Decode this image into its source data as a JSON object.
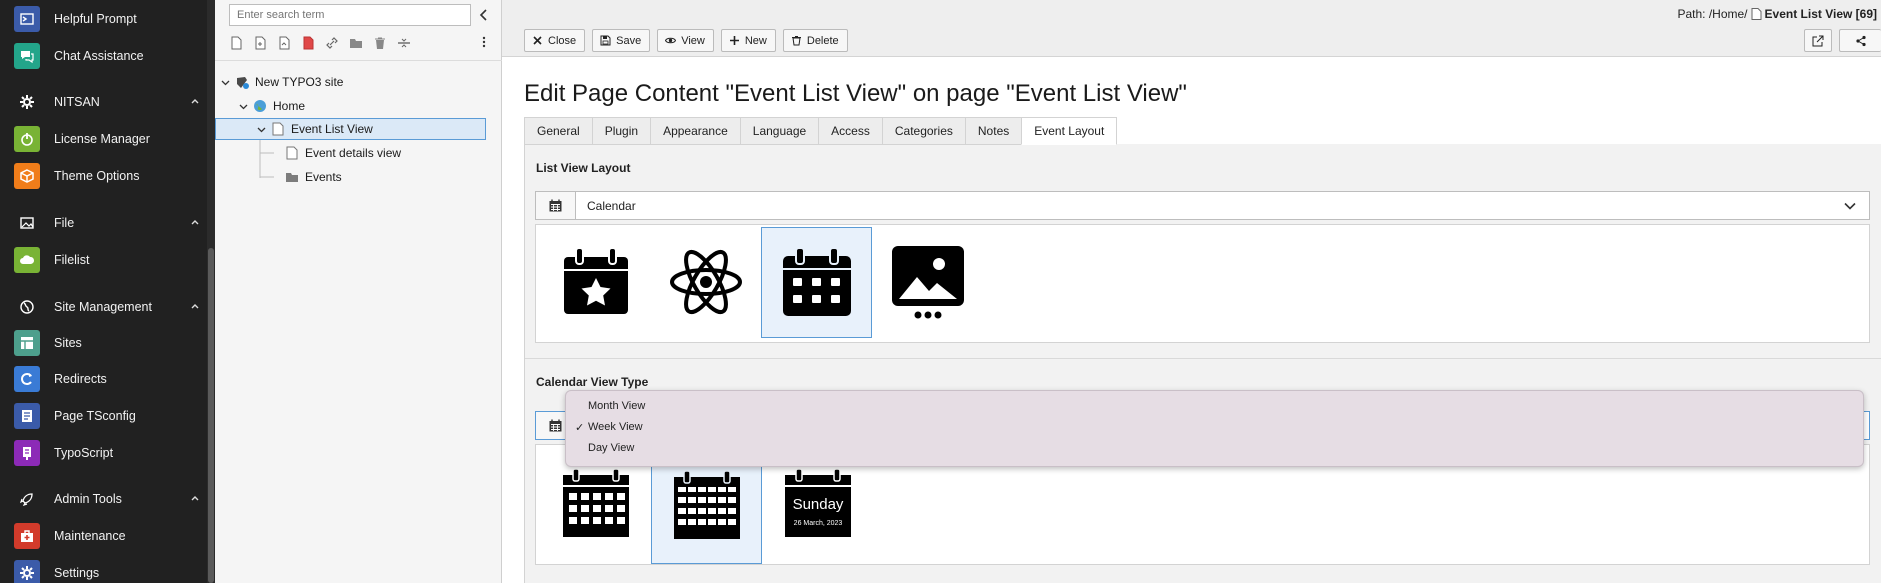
{
  "modules": {
    "items": [
      {
        "label": "Helpful Prompt",
        "icon": "prompt-icon",
        "color": "#3b5ba9"
      },
      {
        "label": "Chat Assistance",
        "icon": "chat-icon",
        "color": "#23a58a"
      },
      {
        "label": "NITSAN",
        "icon": "gear-icon",
        "group": true
      },
      {
        "label": "License Manager",
        "icon": "power-icon",
        "color": "#79b335"
      },
      {
        "label": "Theme Options",
        "icon": "cube-icon",
        "color": "#f07d1a"
      },
      {
        "label": "File",
        "icon": "image-icon",
        "group": true
      },
      {
        "label": "Filelist",
        "icon": "cloud-icon",
        "color": "#79b335"
      },
      {
        "label": "Site Management",
        "icon": "globe-icon",
        "group": true
      },
      {
        "label": "Sites",
        "icon": "sites-icon",
        "color": "#4d9f8c"
      },
      {
        "label": "Redirects",
        "icon": "redirect-icon",
        "color": "#3a7bd5"
      },
      {
        "label": "Page TSconfig",
        "icon": "tsconfig-icon",
        "color": "#3b5ba9"
      },
      {
        "label": "TypoScript",
        "icon": "typoscript-icon",
        "color": "#8c2ab7"
      },
      {
        "label": "Admin Tools",
        "icon": "rocket-icon",
        "group": true
      },
      {
        "label": "Maintenance",
        "icon": "medkit-icon",
        "color": "#d23b2b"
      },
      {
        "label": "Settings",
        "icon": "settings-icon",
        "color": "#3b5ba9"
      }
    ]
  },
  "tree": {
    "search_placeholder": "Enter search term",
    "nodes": [
      {
        "label": "New TYPO3 site"
      },
      {
        "label": "Home"
      },
      {
        "label": "Event List View"
      },
      {
        "label": "Event details view"
      },
      {
        "label": "Events"
      }
    ]
  },
  "header": {
    "path_prefix": "Path: /Home/",
    "path_page": "Event List View [69]",
    "buttons": {
      "close": "Close",
      "save": "Save",
      "view": "View",
      "new": "New",
      "delete": "Delete"
    }
  },
  "form": {
    "title": "Edit Page Content \"Event List View\" on page \"Event List View\"",
    "tabs": [
      "General",
      "Plugin",
      "Appearance",
      "Language",
      "Access",
      "Categories",
      "Notes",
      "Event Layout"
    ],
    "active_tab": "Event Layout",
    "list_view_layout": {
      "label": "List View Layout",
      "value": "Calendar",
      "selected_index": 2
    },
    "calendar_view_type": {
      "label": "Calendar View Type",
      "options": [
        "Month View",
        "Week View",
        "Day View"
      ],
      "selected": "Week View",
      "selected_index": 1,
      "day_icon_text": "Sunday",
      "day_icon_date": "26 March, 2023"
    }
  }
}
